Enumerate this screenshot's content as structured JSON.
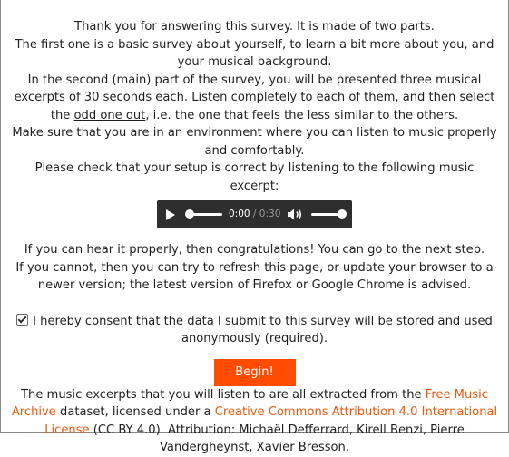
{
  "intro": {
    "p1": "Thank you for answering this survey. It is made of two parts.",
    "p2": "The first one is a basic survey about yourself, to learn a bit more about you, and your musical background.",
    "p3_before": "In the second (main) part of the survey, you will be presented three musical excerpts of 30 seconds each. Listen ",
    "p3_completely": "completely",
    "p3_middle": " to each of them, and then select the ",
    "p3_odd": "odd one out",
    "p3_after": ", i.e. the one that feels the less similar to the others.",
    "p4": "Make sure that you are in an environment where you can listen to music properly and comfortably.",
    "p5": "Please check that your setup is correct by listening to the following music excerpt:"
  },
  "audio": {
    "current_time": "0:00",
    "separator_duration": " / 0:30",
    "progress": 0.0,
    "volume": 1.0,
    "icons": [
      "play-icon",
      "volume-icon"
    ]
  },
  "after_audio": {
    "l1": "If you can hear it properly, then congratulations! You can go to the next step.",
    "l2": "If you cannot, then you can try to refresh this page, or update your browser to a newer version; the latest version of Firefox or Google Chrome is advised."
  },
  "consent": {
    "checked": true,
    "label": "I hereby consent that the data I submit to this survey will be stored and used anonymously (required)."
  },
  "begin_button": "Begin!",
  "footer": {
    "t1": "The music excerpts that you will listen to are all extracted from the ",
    "fma_link": "Free Music Archive",
    "t2": " dataset, licensed under a ",
    "license_link": "Creative Commons Attribution 4.0 International License",
    "t3": " (CC BY 4.0). Attribution: Michaël Defferrard, Kirell Benzi, Pierre Vandergheynst, Xavier Bresson."
  },
  "colors": {
    "accent": "#ff4c00",
    "link": "#e8590c",
    "player_bg": "#2e2e2e"
  }
}
